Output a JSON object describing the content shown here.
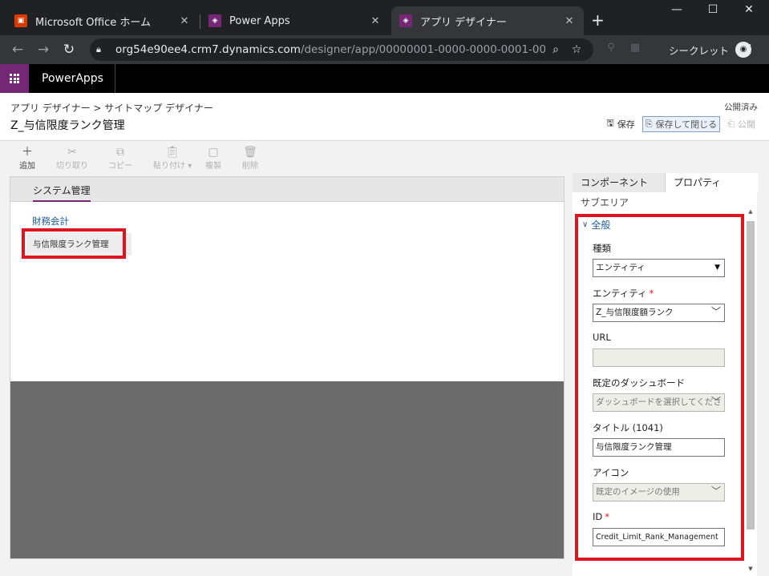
{
  "browser": {
    "tabs": [
      {
        "title": "Microsoft Office ホーム",
        "favicon": "office-icon",
        "color": "#d83b01"
      },
      {
        "title": "Power Apps",
        "favicon": "powerapps-icon",
        "color": "#742774"
      },
      {
        "title": "アプリ デザイナー",
        "favicon": "powerapps-icon",
        "color": "#742774"
      }
    ],
    "url_host": "org54e90ee4.crm7.dynamics.com",
    "url_path": "/designer/app/00000001-0000-0000-0001-00000...",
    "incognito_label": "シークレット"
  },
  "app": {
    "brand": "PowerApps",
    "accent": "#742774"
  },
  "header": {
    "breadcrumb": "アプリ デザイナー > サイトマップ デザイナー",
    "title": "Z_与信限度ランク管理",
    "status": "公開済み",
    "save_label": "保存",
    "save_close_label": "保存して閉じる",
    "publish_label": "公開"
  },
  "commands": {
    "add": "追加",
    "cut": "切り取り",
    "copy": "コピー",
    "paste": "貼り付け",
    "clone": "複製",
    "delete": "削除"
  },
  "canvas": {
    "area_tab": "システム管理",
    "group_title": "財務会計",
    "subarea_item": "与信限度ランク管理"
  },
  "pane": {
    "tab_components": "コンポーネント",
    "tab_properties": "プロパティ",
    "section": "サブエリア",
    "general": "全般",
    "type_label": "種類",
    "type_value": "エンティティ",
    "entity_label": "エンティティ",
    "entity_value": "Z_与信限度額ランク",
    "url_label": "URL",
    "url_value": "",
    "dashboard_label": "既定のダッシュボード",
    "dashboard_placeholder": "ダッシュボードを選択してくださ",
    "title_label": "タイトル (1041)",
    "title_value": "与信限度ランク管理",
    "icon_label": "アイコン",
    "icon_value": "既定のイメージの使用",
    "id_label": "ID",
    "id_value": "Credit_Limit_Rank_Management",
    "required_marker": "*"
  }
}
